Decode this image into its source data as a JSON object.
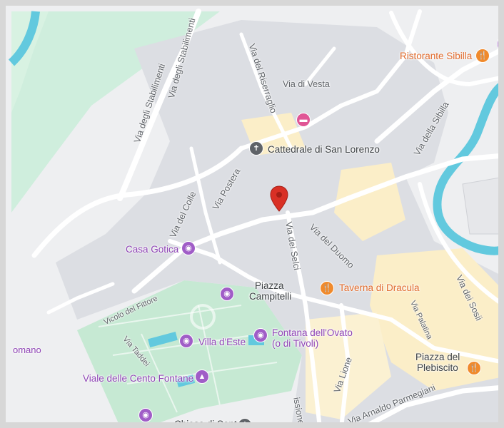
{
  "streets": {
    "via_degli_stabilimenti_1": "Via degli Stabilimenti",
    "via_degli_stabilimenti_2": "Via degli Stabilimenti",
    "via_del_riserraglio": "Via del Riserraglio",
    "via_di_vesta": "Via di Vesta",
    "via_della_sibilla": "Via della Sibilla",
    "via_postera": "Via Postera",
    "via_del_colle": "Via del Colle",
    "via_del_duomo": "Via del Duomo",
    "via_dei_selci": "Via dei Selci",
    "via_dei_sosii": "Via dei Sosii",
    "via_palatina": "Via Palatina",
    "vicolo_del_fittore": "Vicolo del Fittore",
    "via_taddei": "Via Taddei",
    "via_lione": "Via Lione",
    "via_arnaldo_parmegiani": "Via Arnaldo Parmegiani",
    "missione": "issione",
    "romano": "omano"
  },
  "places": {
    "cattedrale": "Cattedrale di San Lorenzo",
    "piazza_campitelli": [
      "Piazza",
      "Campitelli"
    ],
    "piazza_plebiscito": [
      "Piazza del",
      "Plebiscito"
    ],
    "chiesa": "Chiesa di Santa"
  },
  "pois": {
    "ristorante_sibilla": "Ristorante Sibilla",
    "casa_gotica": "Casa Gotica",
    "taverna_di_dracula": "Taverna di Dracula",
    "villa_deste": "Villa d'Este",
    "fontana_ovato": [
      "Fontana dell'Ovato",
      "(o di Tivoli)"
    ],
    "viale_cento_fontane": "Viale delle Cento Fontane"
  },
  "colors": {
    "park": "#c9ead3",
    "river": "#62c9de",
    "building": "#dcdee3",
    "road": "#ffffff",
    "highlight": "#fdefc3",
    "poi_purple": "#a05dc7",
    "poi_orange": "#f08a2c",
    "pin_red": "#d93025"
  },
  "icons": [
    "location-pin-icon",
    "church-icon",
    "hotel-icon",
    "camera-icon",
    "restaurant-icon",
    "fountain-icon",
    "monument-icon"
  ]
}
